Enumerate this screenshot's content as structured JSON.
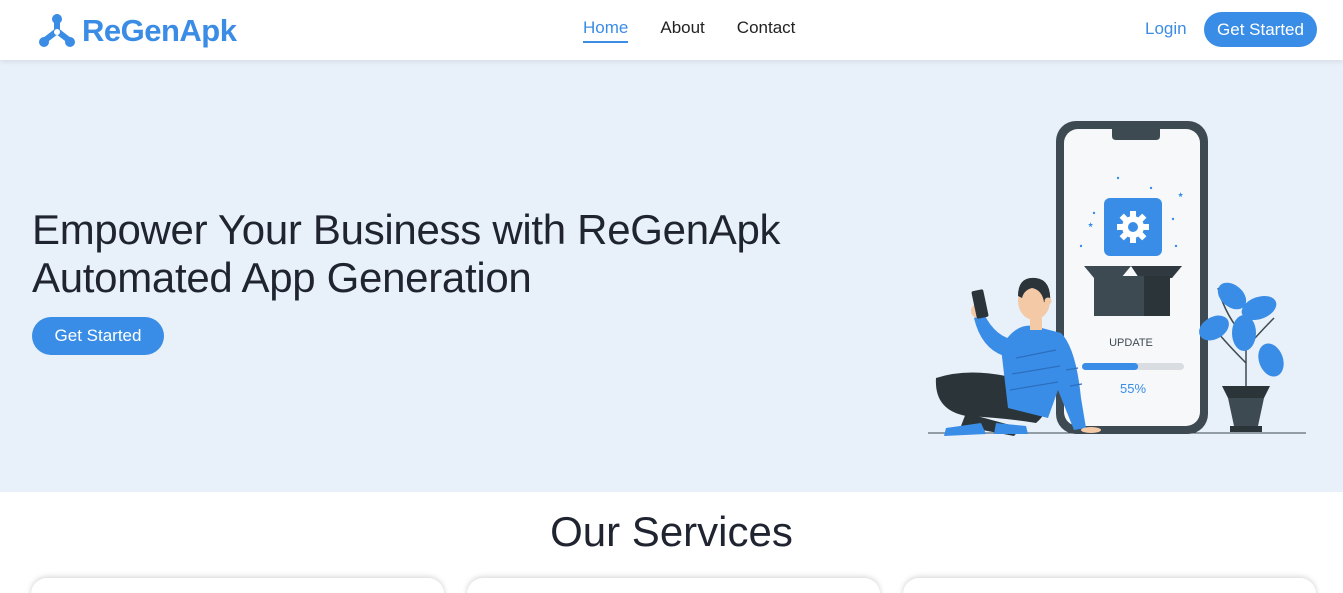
{
  "brand": {
    "name": "ReGenApk",
    "logo_icon": "tri-ring-logo-icon",
    "color": "#3b8ce5"
  },
  "nav": {
    "items": [
      {
        "label": "Home",
        "active": true
      },
      {
        "label": "About",
        "active": false
      },
      {
        "label": "Contact",
        "active": false
      }
    ],
    "login_label": "Login",
    "cta_label": "Get Started"
  },
  "hero": {
    "title_line1": "Empower Your Business with ReGenApk",
    "title_line2": "Automated App Generation",
    "cta_label": "Get Started",
    "background": "#e8f0fa",
    "illustration": {
      "status_label": "UPDATE",
      "progress_text": "55%",
      "progress": 0.55,
      "icon": "gear-icon"
    }
  },
  "services": {
    "title": "Our Services",
    "card_count_visible": 3
  },
  "colors": {
    "accent": "#3a8de6",
    "dark": "#1f2430",
    "phone": "#3e4a52"
  }
}
